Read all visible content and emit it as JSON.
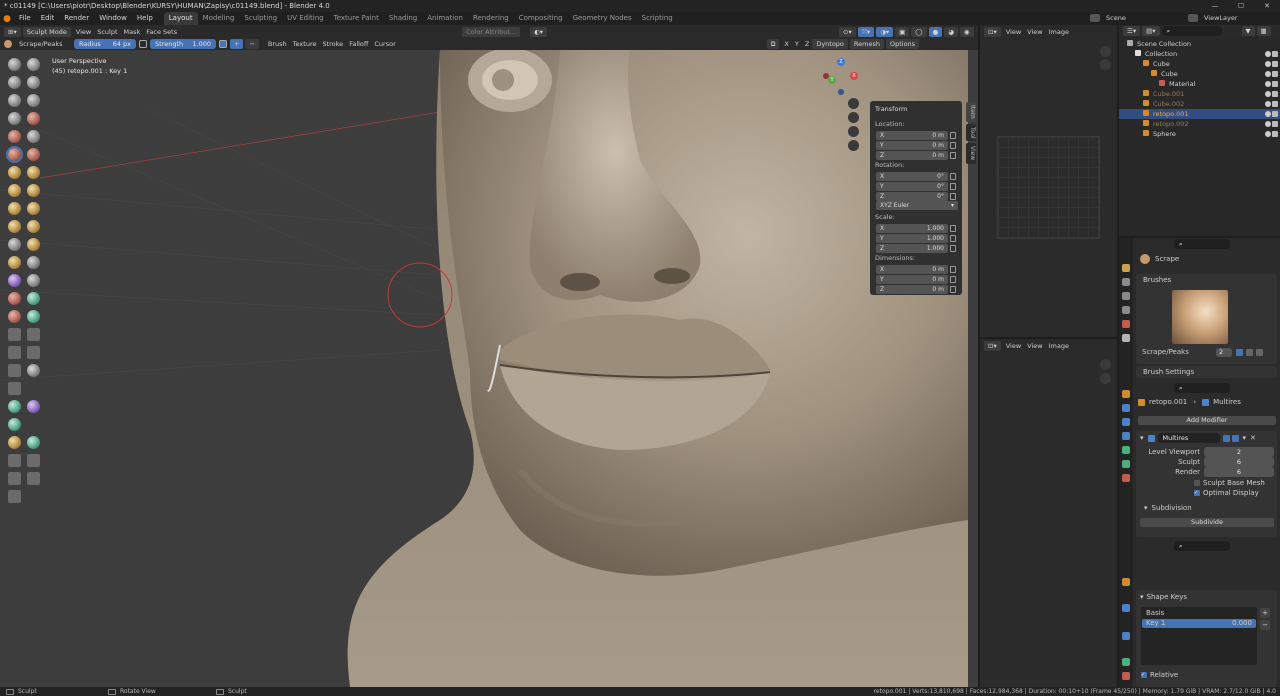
{
  "window": {
    "title": "* c01149 [C:\\Users\\piotr\\Desktop\\Blender\\KURSY\\HUMAN\\Zapisy\\c01149.blend] - Blender 4.0"
  },
  "menu": [
    "File",
    "Edit",
    "Render",
    "Window",
    "Help"
  ],
  "workspaces": [
    {
      "label": "Layout",
      "active": true
    },
    {
      "label": "Modeling"
    },
    {
      "label": "Sculpting"
    },
    {
      "label": "UV Editing"
    },
    {
      "label": "Texture Paint"
    },
    {
      "label": "Shading"
    },
    {
      "label": "Animation"
    },
    {
      "label": "Rendering"
    },
    {
      "label": "Compositing"
    },
    {
      "label": "Geometry Nodes"
    },
    {
      "label": "Scripting"
    }
  ],
  "topright": {
    "scene": "Scene",
    "view_layer": "ViewLayer"
  },
  "viewport_header": {
    "mode": "Sculpt Mode",
    "menus": [
      "View",
      "Sculpt",
      "Mask",
      "Face Sets"
    ],
    "color_attribute": "Color Attribut...",
    "axes": [
      "X",
      "Y",
      "Z"
    ],
    "dyntopo": "Dyntopo",
    "remesh": "Remesh",
    "options": "Options"
  },
  "tool_header": {
    "brush_name": "Scrape/Peaks",
    "radius_label": "Radius",
    "radius_value": "64 px",
    "strength_label": "Strength",
    "strength_value": "1.000",
    "plus": "+",
    "minus": "−",
    "menus": [
      "Brush",
      "Texture",
      "Stroke",
      "Falloff",
      "Cursor"
    ]
  },
  "viewport_overlay": {
    "line1": "User Perspective",
    "line2": "(45) retopo.001 : Key 1"
  },
  "gizmo": {
    "x": "X",
    "y": "Y",
    "z": "Z"
  },
  "transform_panel": {
    "title": "Transform",
    "location_label": "Location:",
    "location": [
      {
        "k": "X",
        "v": "0 m"
      },
      {
        "k": "Y",
        "v": "0 m"
      },
      {
        "k": "Z",
        "v": "0 m"
      }
    ],
    "rotation_label": "Rotation:",
    "rotation": [
      {
        "k": "X",
        "v": "0°"
      },
      {
        "k": "Y",
        "v": "0°"
      },
      {
        "k": "Z",
        "v": "0°"
      }
    ],
    "rotation_mode": "XYZ Euler",
    "scale_label": "Scale:",
    "scale": [
      {
        "k": "X",
        "v": "1.000"
      },
      {
        "k": "Y",
        "v": "1.000"
      },
      {
        "k": "Z",
        "v": "1.000"
      }
    ],
    "dimensions_label": "Dimensions:",
    "dimensions": [
      {
        "k": "X",
        "v": "0 m"
      },
      {
        "k": "Y",
        "v": "0 m"
      },
      {
        "k": "Z",
        "v": "0 m"
      }
    ]
  },
  "side_tabs": [
    "Item",
    "Tool",
    "View"
  ],
  "right_top_header": {
    "view": "View",
    "view2": "View",
    "image": "Image"
  },
  "right_bot_header": {
    "view": "View",
    "view2": "View",
    "image": "Image"
  },
  "outliner": {
    "rows": [
      {
        "label": "Scene Collection",
        "indent": 0
      },
      {
        "label": "Collection",
        "indent": 1
      },
      {
        "label": "Cube",
        "indent": 2
      },
      {
        "label": "Cube",
        "indent": 3
      },
      {
        "label": "Material",
        "indent": 4
      },
      {
        "label": "Cube.001",
        "indent": 2,
        "dim": true
      },
      {
        "label": "Cube.002",
        "indent": 2,
        "dim": true
      },
      {
        "label": "retopo.001",
        "indent": 2,
        "sel": true
      },
      {
        "label": "retopo.002",
        "indent": 2,
        "dim": true
      },
      {
        "label": "Sphere",
        "indent": 2
      }
    ]
  },
  "brush_props": {
    "tool": "Scrape",
    "brushes": "Brushes",
    "brush_name": "Scrape/Peaks",
    "user_count": "2",
    "settings": "Brush Settings"
  },
  "modifier_props": {
    "object": "retopo.001",
    "modifier_type": "Multires",
    "add": "Add Modifier",
    "name": "Multires",
    "level_viewport_label": "Level Viewport",
    "level_viewport": "2",
    "sculpt_label": "Sculpt",
    "sculpt": "6",
    "render_label": "Render",
    "render": "6",
    "sculpt_base": "Sculpt Base Mesh",
    "optimal": "Optimal Display",
    "subdivision": "Subdivision",
    "subdivide": "Subdivide"
  },
  "shape_keys": {
    "title": "Shape Keys",
    "keys": [
      {
        "label": "Basis"
      },
      {
        "label": "Key 1",
        "value": "0.000",
        "sel": true
      }
    ],
    "relative": "Relative"
  },
  "statusbar": {
    "left1": "Sculpt",
    "left2": "Rotate View",
    "left3": "Sculpt",
    "right": "retopo.001 | Verts:13,810,698 | Faces:12,984,368 | Duration: 00:10+10 (Frame 45/250) | Memory: 1.79 GiB | VRAM: 2.7/12.0 GiB | 4.0"
  },
  "colors": {
    "accent": "#4772b3",
    "header": "#2a2a2a",
    "viewport": "#3d3d3d",
    "skin": "#a89a89"
  }
}
